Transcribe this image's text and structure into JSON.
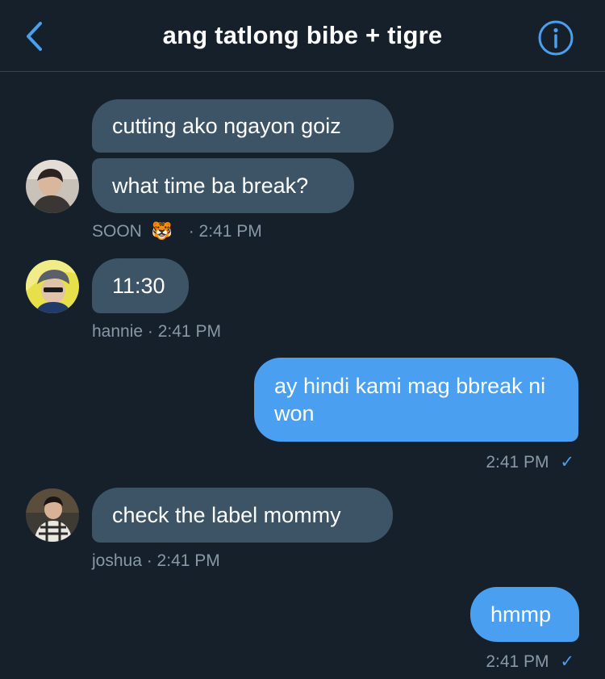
{
  "header": {
    "title": "ang tatlong bibe + tigre",
    "back_icon": "chevron-left-icon",
    "info_icon": "info-icon",
    "accent": "#4a9ff0"
  },
  "colors": {
    "background": "#15202b",
    "incoming_bubble": "#3d5466",
    "outgoing_bubble": "#4a9ff0",
    "meta_text": "#8899a6"
  },
  "messages": [
    {
      "text": "cutting ako ngayon goiz",
      "direction": "in"
    },
    {
      "text": "what time ba break?",
      "direction": "in"
    },
    {
      "text": "11:30",
      "direction": "in"
    },
    {
      "text": "ay hindi kami mag bbreak ni won",
      "direction": "out"
    },
    {
      "text": "check the label mommy",
      "direction": "in"
    },
    {
      "text": "hmmp",
      "direction": "out"
    }
  ],
  "meta": [
    {
      "sender": "SOON",
      "emoji": "🐯",
      "time": "· 2:41 PM"
    },
    {
      "sender": "hannie",
      "time": "· 2:41 PM"
    },
    {
      "time": "2:41 PM",
      "check": "✓"
    },
    {
      "sender": "joshua",
      "time": "· 2:41 PM"
    },
    {
      "time": "2:41 PM",
      "check": "✓"
    }
  ]
}
